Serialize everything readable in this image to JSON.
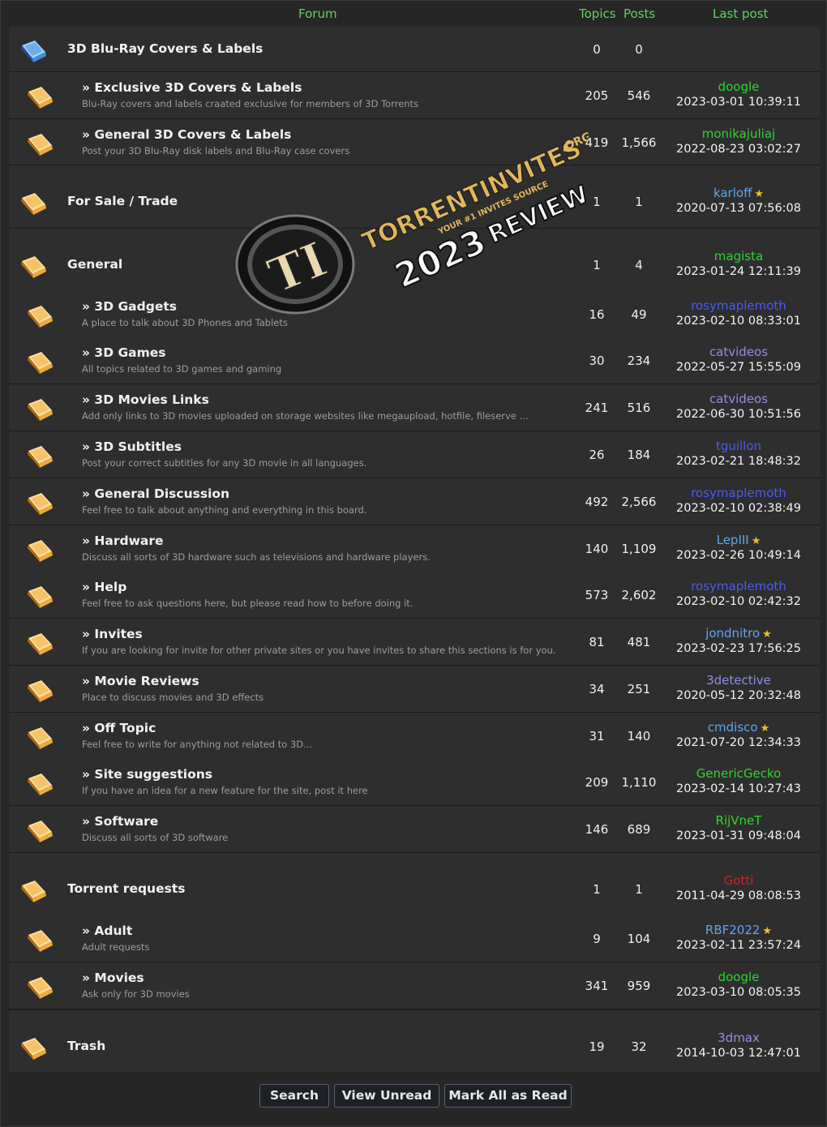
{
  "header": {
    "forum": "Forum",
    "topics": "Topics",
    "posts": "Posts",
    "last_post": "Last post"
  },
  "rows": [
    {
      "kind": "cat",
      "icon": "blue",
      "title": "3D Blu-Ray Covers & Labels",
      "desc": "",
      "topics": "0",
      "posts": "0",
      "user": "",
      "user_color": "",
      "star": false,
      "date": ""
    },
    {
      "kind": "sub",
      "icon": "orange",
      "title": "» Exclusive 3D Covers & Labels",
      "desc": "Blu-Ray covers and labels craated exclusive for members of 3D Torrents",
      "topics": "205",
      "posts": "546",
      "user": "doogle",
      "user_color": "#2fd42f",
      "star": false,
      "date": "2023-03-01 10:39:11"
    },
    {
      "kind": "sub",
      "icon": "orange",
      "title": "» General 3D Covers & Labels",
      "desc": "Post your 3D Blu-Ray disk labels and Blu-Ray case covers",
      "topics": "419",
      "posts": "1,566",
      "user": "monikajuliaj",
      "user_color": "#2fd42f",
      "star": false,
      "date": "2022-08-23 03:02:27"
    },
    {
      "kind": "cat",
      "icon": "orange",
      "title": "For Sale / Trade",
      "desc": "",
      "topics": "1",
      "posts": "1",
      "user": "karloff",
      "user_color": "#5da7f0",
      "star": true,
      "date": "2020-07-13 07:56:08"
    },
    {
      "kind": "cat",
      "icon": "orange",
      "title": "General",
      "desc": "",
      "topics": "1",
      "posts": "4",
      "user": "magista",
      "user_color": "#2fd42f",
      "star": false,
      "date": "2023-01-24 12:11:39"
    },
    {
      "kind": "sub",
      "icon": "orange",
      "title": "» 3D Gadgets",
      "desc": "A place to talk about 3D Phones and Tablets",
      "topics": "16",
      "posts": "49",
      "user": "rosymaplemoth",
      "user_color": "#4a5cf0",
      "star": false,
      "date": "2023-02-10 08:33:01"
    },
    {
      "kind": "sub",
      "icon": "orange",
      "title": "» 3D Games",
      "desc": "All topics related to 3D games and gaming",
      "topics": "30",
      "posts": "234",
      "user": "catvideos",
      "user_color": "#8f8fe8",
      "star": false,
      "date": "2022-05-27 15:55:09"
    },
    {
      "kind": "sub",
      "icon": "orange",
      "title": "» 3D Movies Links",
      "desc": "Add only links to 3D movies uploaded on storage websites like megaupload, hotfile, fileserve ...",
      "topics": "241",
      "posts": "516",
      "user": "catvideos",
      "user_color": "#8f8fe8",
      "star": false,
      "date": "2022-06-30 10:51:56"
    },
    {
      "kind": "sub",
      "icon": "orange",
      "title": "» 3D Subtitles",
      "desc": "Post your correct subtitles for any 3D movie in all languages.",
      "topics": "26",
      "posts": "184",
      "user": "tguillon",
      "user_color": "#4a5cf0",
      "star": false,
      "date": "2023-02-21 18:48:32"
    },
    {
      "kind": "sub",
      "icon": "orange",
      "title": "» General Discussion",
      "desc": "Feel free to talk about anything and everything in this board.",
      "topics": "492",
      "posts": "2,566",
      "user": "rosymaplemoth",
      "user_color": "#4a5cf0",
      "star": false,
      "date": "2023-02-10 02:38:49"
    },
    {
      "kind": "sub",
      "icon": "orange",
      "title": "» Hardware",
      "desc": "Discuss all sorts of 3D hardware such as televisions and hardware players.",
      "topics": "140",
      "posts": "1,109",
      "user": "LepIII",
      "user_color": "#5da7f0",
      "star": true,
      "date": "2023-02-26 10:49:14"
    },
    {
      "kind": "sub",
      "icon": "orange",
      "title": "» Help",
      "desc": "Feel free to ask questions here, but please read how to before doing it.",
      "topics": "573",
      "posts": "2,602",
      "user": "rosymaplemoth",
      "user_color": "#4a5cf0",
      "star": false,
      "date": "2023-02-10 02:42:32"
    },
    {
      "kind": "sub",
      "icon": "orange",
      "title": "» Invites",
      "desc": "If you are looking for invite for other private sites or you have invites to share this sections is for you.",
      "topics": "81",
      "posts": "481",
      "user": "jondnitro",
      "user_color": "#5da7f0",
      "star": true,
      "date": "2023-02-23 17:56:25"
    },
    {
      "kind": "sub",
      "icon": "orange",
      "title": "» Movie Reviews",
      "desc": "Place to discuss movies and 3D effects",
      "topics": "34",
      "posts": "251",
      "user": "3detective",
      "user_color": "#8f8fe8",
      "star": false,
      "date": "2020-05-12 20:32:48"
    },
    {
      "kind": "sub",
      "icon": "orange",
      "title": "» Off Topic",
      "desc": "Feel free to write for anything not related to 3D...",
      "topics": "31",
      "posts": "140",
      "user": "cmdisco",
      "user_color": "#5da7f0",
      "star": true,
      "date": "2021-07-20 12:34:33"
    },
    {
      "kind": "sub",
      "icon": "orange",
      "title": "» Site suggestions",
      "desc": "If you have an idea for a new feature for the site, post it here",
      "topics": "209",
      "posts": "1,110",
      "user": "GenericGecko",
      "user_color": "#2fd42f",
      "star": false,
      "date": "2023-02-14 10:27:43"
    },
    {
      "kind": "sub",
      "icon": "orange",
      "title": "» Software",
      "desc": "Discuss all sorts of 3D software",
      "topics": "146",
      "posts": "689",
      "user": "RijVneT",
      "user_color": "#2fd42f",
      "star": false,
      "date": "2023-01-31 09:48:04"
    },
    {
      "kind": "cat",
      "icon": "orange",
      "title": "Torrent requests",
      "desc": "",
      "topics": "1",
      "posts": "1",
      "user": "Gotti",
      "user_color": "#d42020",
      "star": false,
      "date": "2011-04-29 08:08:53"
    },
    {
      "kind": "sub",
      "icon": "orange",
      "title": "» Adult",
      "desc": "Adult requests",
      "topics": "9",
      "posts": "104",
      "user": "RBF2022",
      "user_color": "#5da7f0",
      "star": true,
      "date": "2023-02-11 23:57:24"
    },
    {
      "kind": "sub",
      "icon": "orange",
      "title": "» Movies",
      "desc": "Ask only for 3D movies",
      "topics": "341",
      "posts": "959",
      "user": "doogle",
      "user_color": "#2fd42f",
      "star": false,
      "date": "2023-03-10 08:05:35"
    },
    {
      "kind": "cat",
      "icon": "orange",
      "title": "Trash",
      "desc": "",
      "topics": "19",
      "posts": "32",
      "user": "3dmax",
      "user_color": "#8f8fe8",
      "star": false,
      "date": "2014-10-03 12:47:01"
    }
  ],
  "buttons": {
    "search": "Search",
    "view_unread": "View Unread",
    "mark_all_read": "Mark All as Read"
  },
  "watermark": {
    "brand": "TORRENTINVITES",
    "tld": ".ORG",
    "tagline": "YOUR #1 INVITES SOURCE",
    "year": "2023",
    "review": "REVIEW",
    "logo": "TI"
  }
}
